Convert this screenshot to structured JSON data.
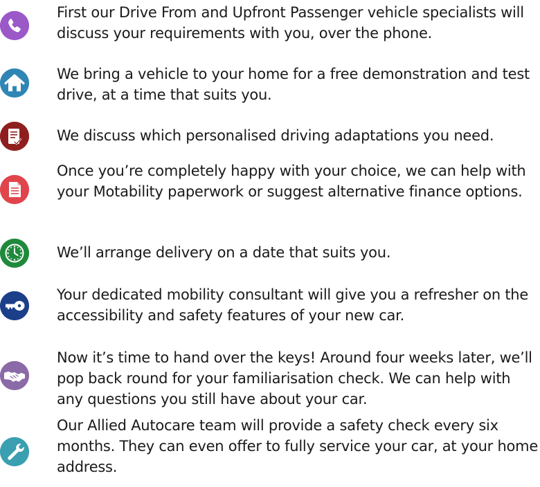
{
  "steps": [
    {
      "icon": "phone-icon",
      "color": "#9b59c8",
      "text": "First our Drive From and Upfront Passenger vehicle specialists will discuss your requirements with you, over the phone."
    },
    {
      "icon": "home-icon",
      "color": "#2f86b5",
      "text": "We bring a vehicle to your home for a free demonstration and test drive, at a time that suits you."
    },
    {
      "icon": "checklist-icon",
      "color": "#8f1f1f",
      "text": "We discuss which personalised driving adaptations you need."
    },
    {
      "icon": "document-icon",
      "color": "#e0454c",
      "text": "Once you’re completely happy with your choice, we can help with your Motability paperwork or suggest alternative finance options."
    },
    {
      "icon": "clock-icon",
      "color": "#1f8a3c",
      "text": "We’ll arrange delivery on a date that suits you."
    },
    {
      "icon": "key-icon",
      "color": "#1c3f8a",
      "text": "Your dedicated mobility consultant will give you a refresher on the accessibility and safety features of your new car."
    },
    {
      "icon": "handshake-icon",
      "color": "#8b6aa8",
      "text": "Now it’s time to hand over the keys!  Around four weeks later, we’ll pop back round for your familiarisation check.  We can help with any questions you still have about your car."
    },
    {
      "icon": "wrench-icon",
      "color": "#3a9fb0",
      "text": "Our Allied Autocare team will provide a safety check every six months.  They can even offer to fully service your car, at your home address."
    }
  ]
}
